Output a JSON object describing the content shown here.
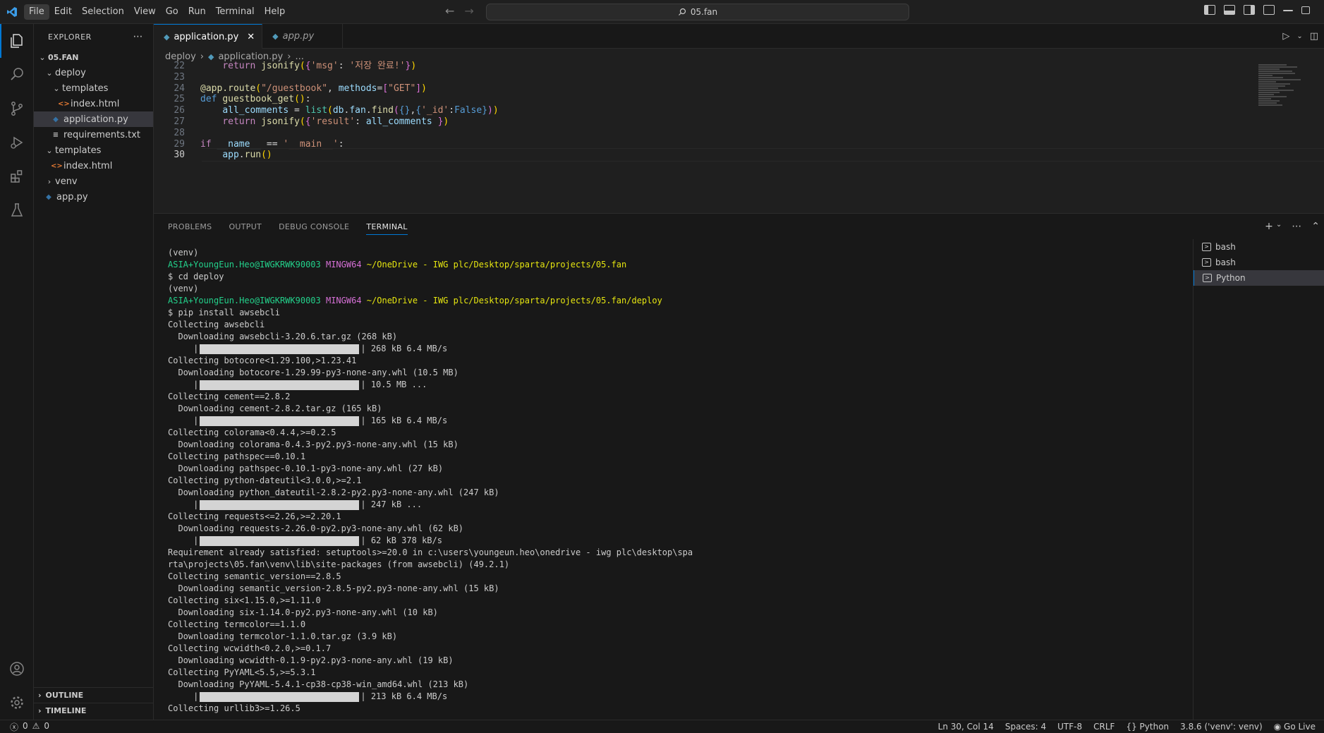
{
  "menu": [
    "File",
    "Edit",
    "Selection",
    "View",
    "Go",
    "Run",
    "Terminal",
    "Help"
  ],
  "search": {
    "text": "05.fan"
  },
  "sidebar": {
    "title": "EXPLORER",
    "root": "05.FAN",
    "tree": [
      {
        "label": "deploy",
        "type": "folder-open",
        "indent": 1
      },
      {
        "label": "templates",
        "type": "folder-open",
        "indent": 2
      },
      {
        "label": "index.html",
        "type": "html",
        "indent": 3
      },
      {
        "label": "application.py",
        "type": "py",
        "indent": 2,
        "selected": true
      },
      {
        "label": "requirements.txt",
        "type": "txt",
        "indent": 2
      },
      {
        "label": "templates",
        "type": "folder-open",
        "indent": 1
      },
      {
        "label": "index.html",
        "type": "html",
        "indent": 2
      },
      {
        "label": "venv",
        "type": "folder-closed",
        "indent": 1
      },
      {
        "label": "app.py",
        "type": "py",
        "indent": 1
      }
    ],
    "outline": "OUTLINE",
    "timeline": "TIMELINE"
  },
  "tabs": [
    {
      "label": "application.py",
      "active": true
    },
    {
      "label": "app.py",
      "active": false
    }
  ],
  "breadcrumb": {
    "folder": "deploy",
    "file": "application.py",
    "more": "..."
  },
  "editor": {
    "lines": [
      {
        "n": "22",
        "html": "    <span class='k'>return</span> <span class='f'>jsonify</span><span class='p'>(</span><span class='pb'>{</span><span class='s'>'msg'</span>: <span class='s'>'저장 완료!'</span><span class='pb'>}</span><span class='p'>)</span>"
      },
      {
        "n": "23",
        "html": ""
      },
      {
        "n": "24",
        "html": "<span class='f'>@app.route</span><span class='p'>(</span><span class='s'>\"/guestbook\"</span>, <span class='v'>methods</span>=<span class='pb'>[</span><span class='s'>\"GET\"</span><span class='pb'>]</span><span class='p'>)</span>"
      },
      {
        "n": "25",
        "html": "<span class='kf'>def</span> <span class='f'>guestbook_get</span><span class='p'>()</span>:"
      },
      {
        "n": "26",
        "html": "    <span class='v'>all_comments</span> = <span class='c'>list</span><span class='p'>(</span><span class='v'>db</span>.<span class='v'>fan</span>.<span class='f'>find</span><span class='pb'>(</span><span class='kf'>{}</span>,<span class='kf'>{</span><span class='s'>'_id'</span>:<span class='kf'>False</span><span class='kf'>}</span><span class='pb'>)</span><span class='p'>)</span>"
      },
      {
        "n": "27",
        "html": "    <span class='k'>return</span> <span class='f'>jsonify</span><span class='p'>(</span><span class='pb'>{</span><span class='s'>'result'</span>: <span class='v'>all_comments</span> <span class='pb'>}</span><span class='p'>)</span>"
      },
      {
        "n": "28",
        "html": ""
      },
      {
        "n": "29",
        "html": "<span class='k'>if</span> <span class='v'>__name__</span> == <span class='s'>'__main__'</span>:"
      },
      {
        "n": "30",
        "html": "    <span class='v'>app</span>.<span class='f'>run</span><span class='p'>()</span>"
      }
    ]
  },
  "panel": {
    "tabs": [
      "PROBLEMS",
      "OUTPUT",
      "DEBUG CONSOLE",
      "TERMINAL"
    ],
    "terminals": [
      {
        "label": "bash",
        "selected": false
      },
      {
        "label": "bash",
        "selected": false
      },
      {
        "label": "Python",
        "selected": true
      }
    ],
    "lines": [
      {
        "t": "(venv)"
      },
      {
        "t": "prompt",
        "user": "ASIA+YoungEun.Heo@IWGKRWK90003",
        "host": "MINGW64",
        "path": "~/OneDrive - IWG plc/Desktop/sparta/projects/05.fan"
      },
      {
        "t": "$ cd deploy"
      },
      {
        "t": "(venv)"
      },
      {
        "t": "prompt",
        "user": "ASIA+YoungEun.Heo@IWGKRWK90003",
        "host": "MINGW64",
        "path": "~/OneDrive - IWG plc/Desktop/sparta/projects/05.fan/deploy"
      },
      {
        "t": "$ pip install awsebcli"
      },
      {
        "t": "Collecting awsebcli"
      },
      {
        "t": "  Downloading awsebcli-3.20.6.tar.gz (268 kB)"
      },
      {
        "t": "bar",
        "after": " 268 kB 6.4 MB/s"
      },
      {
        "t": "Collecting botocore<1.29.100,>1.23.41"
      },
      {
        "t": "  Downloading botocore-1.29.99-py3-none-any.whl (10.5 MB)"
      },
      {
        "t": "bar",
        "after": " 10.5 MB ..."
      },
      {
        "t": "Collecting cement==2.8.2"
      },
      {
        "t": "  Downloading cement-2.8.2.tar.gz (165 kB)"
      },
      {
        "t": "bar",
        "after": " 165 kB 6.4 MB/s"
      },
      {
        "t": "Collecting colorama<0.4.4,>=0.2.5"
      },
      {
        "t": "  Downloading colorama-0.4.3-py2.py3-none-any.whl (15 kB)"
      },
      {
        "t": "Collecting pathspec==0.10.1"
      },
      {
        "t": "  Downloading pathspec-0.10.1-py3-none-any.whl (27 kB)"
      },
      {
        "t": "Collecting python-dateutil<3.0.0,>=2.1"
      },
      {
        "t": "  Downloading python_dateutil-2.8.2-py2.py3-none-any.whl (247 kB)"
      },
      {
        "t": "bar",
        "after": " 247 kB ..."
      },
      {
        "t": "Collecting requests<=2.26,>=2.20.1"
      },
      {
        "t": "  Downloading requests-2.26.0-py2.py3-none-any.whl (62 kB)"
      },
      {
        "t": "bar",
        "after": " 62 kB 378 kB/s"
      },
      {
        "t": "Requirement already satisfied: setuptools>=20.0 in c:\\users\\youngeun.heo\\onedrive - iwg plc\\desktop\\spa"
      },
      {
        "t": "rta\\projects\\05.fan\\venv\\lib\\site-packages (from awsebcli) (49.2.1)"
      },
      {
        "t": "Collecting semantic_version==2.8.5"
      },
      {
        "t": "  Downloading semantic_version-2.8.5-py2.py3-none-any.whl (15 kB)"
      },
      {
        "t": "Collecting six<1.15.0,>=1.11.0"
      },
      {
        "t": "  Downloading six-1.14.0-py2.py3-none-any.whl (10 kB)"
      },
      {
        "t": "Collecting termcolor==1.1.0"
      },
      {
        "t": "  Downloading termcolor-1.1.0.tar.gz (3.9 kB)"
      },
      {
        "t": "Collecting wcwidth<0.2.0,>=0.1.7"
      },
      {
        "t": "  Downloading wcwidth-0.1.9-py2.py3-none-any.whl (19 kB)"
      },
      {
        "t": "Collecting PyYAML<5.5,>=5.3.1"
      },
      {
        "t": "  Downloading PyYAML-5.4.1-cp38-cp38-win_amd64.whl (213 kB)"
      },
      {
        "t": "bar",
        "after": " 213 kB 6.4 MB/s"
      },
      {
        "t": "Collecting urllib3>=1.26.5"
      }
    ]
  },
  "statusbar": {
    "errors": "0",
    "warnings": "0",
    "position": "Ln 30, Col 14",
    "spaces": "Spaces: 4",
    "encoding": "UTF-8",
    "eol": "CRLF",
    "language": "Python",
    "interpreter": "3.8.6 ('venv': venv)",
    "golive": "Go Live"
  },
  "colors": {
    "accent": "#0078d4",
    "background": "#181818",
    "editor": "#1f1f1f"
  }
}
